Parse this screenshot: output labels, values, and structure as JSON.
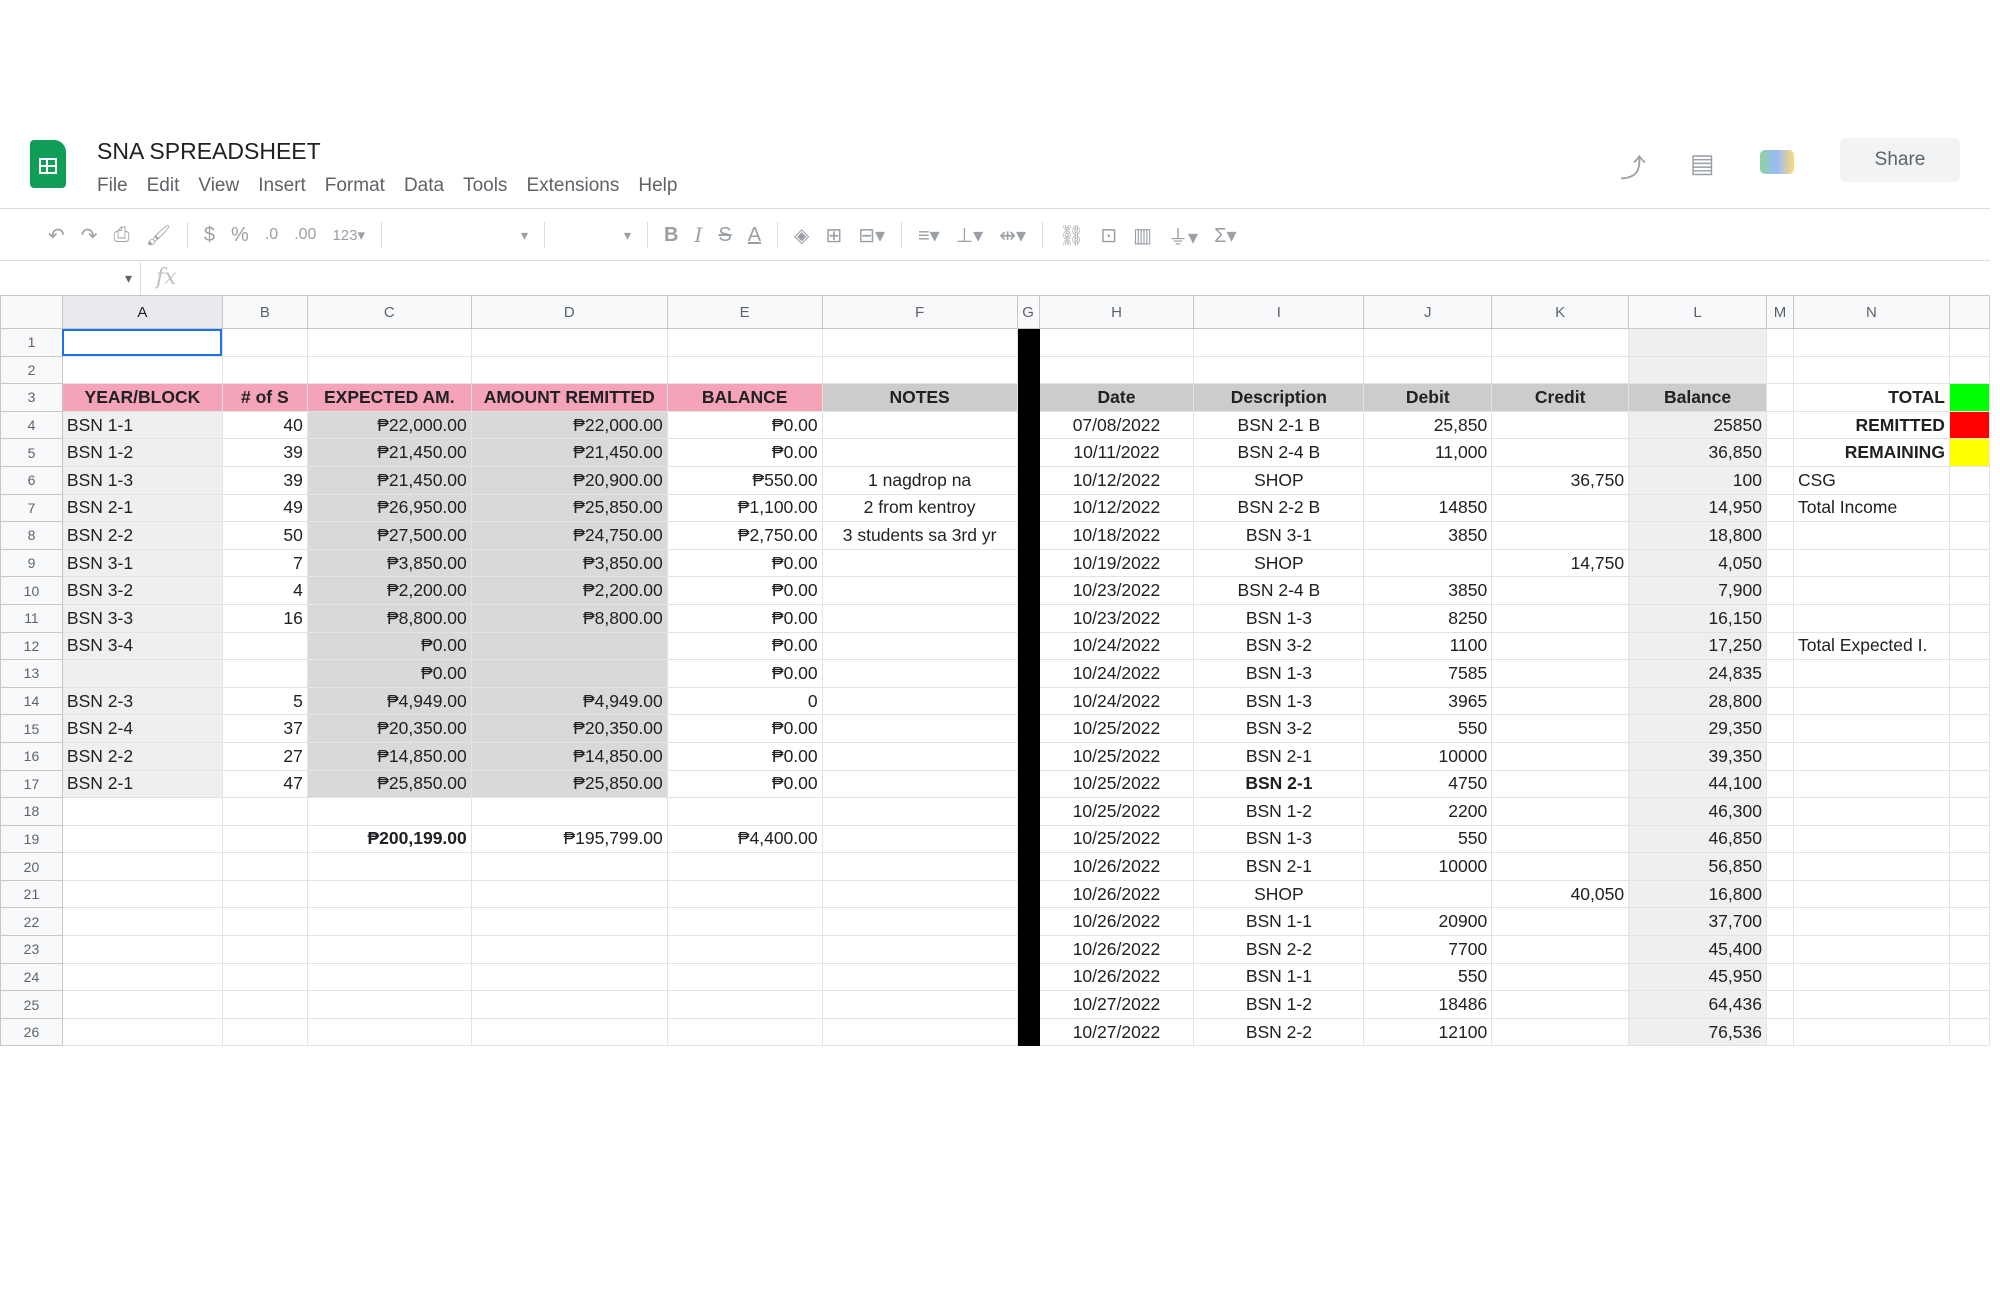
{
  "app": {
    "title": "SNA SPREADSHEET",
    "menu": [
      "File",
      "Edit",
      "View",
      "Insert",
      "Format",
      "Data",
      "Tools",
      "Extensions",
      "Help"
    ],
    "share_label": "Share"
  },
  "toolbar": {
    "currency": "$",
    "percent": "%",
    "dec_less": ".0",
    "dec_more": ".00",
    "format_more": "123▾",
    "fx": "fx"
  },
  "columns": [
    "A",
    "B",
    "C",
    "D",
    "E",
    "F",
    "G",
    "H",
    "I",
    "J",
    "K",
    "L",
    "M",
    "N"
  ],
  "rows": [
    {
      "n": "1"
    },
    {
      "n": "2"
    },
    {
      "n": "3",
      "A": "YEAR/BLOCK",
      "B": "# of S",
      "C": "EXPECTED AM.",
      "D": "AMOUNT REMITTED",
      "E": "BALANCE",
      "F": "NOTES",
      "H": "Date",
      "I": "Description",
      "J": "Debit",
      "K": "Credit",
      "L": "Balance",
      "N": "TOTAL"
    },
    {
      "n": "4",
      "A": "BSN 1-1",
      "B": "40",
      "C": "₱22,000.00",
      "D": "₱22,000.00",
      "E": "₱0.00",
      "H": "07/08/2022",
      "I": "BSN 2-1 B",
      "J": "25,850",
      "L": "25850",
      "N": "REMITTED"
    },
    {
      "n": "5",
      "A": "BSN 1-2",
      "B": "39",
      "C": "₱21,450.00",
      "D": "₱21,450.00",
      "E": "₱0.00",
      "H": "10/11/2022",
      "I": "BSN 2-4 B",
      "J": "11,000",
      "L": "36,850",
      "N": "REMAINING"
    },
    {
      "n": "6",
      "A": "BSN 1-3",
      "B": "39",
      "C": "₱21,450.00",
      "D": "₱20,900.00",
      "E": "₱550.00",
      "F": "1 nagdrop na",
      "H": "10/12/2022",
      "I": "SHOP",
      "K": "36,750",
      "L": "100",
      "N": "CSG"
    },
    {
      "n": "7",
      "A": "BSN 2-1",
      "B": "49",
      "C": "₱26,950.00",
      "D": "₱25,850.00",
      "E": "₱1,100.00",
      "F": "2 from kentroy",
      "H": "10/12/2022",
      "I": "BSN 2-2 B",
      "J": "14850",
      "L": "14,950",
      "N": "Total Income"
    },
    {
      "n": "8",
      "A": "BSN 2-2",
      "B": "50",
      "C": "₱27,500.00",
      "D": "₱24,750.00",
      "E": "₱2,750.00",
      "F": "3 students sa 3rd yr",
      "H": "10/18/2022",
      "I": "BSN 3-1",
      "J": "3850",
      "L": "18,800"
    },
    {
      "n": "9",
      "A": "BSN 3-1",
      "B": "7",
      "C": "₱3,850.00",
      "D": "₱3,850.00",
      "E": "₱0.00",
      "H": "10/19/2022",
      "I": "SHOP",
      "K": "14,750",
      "L": "4,050"
    },
    {
      "n": "10",
      "A": "BSN 3-2",
      "B": "4",
      "C": "₱2,200.00",
      "D": "₱2,200.00",
      "E": "₱0.00",
      "H": "10/23/2022",
      "I": "BSN 2-4 B",
      "J": "3850",
      "L": "7,900"
    },
    {
      "n": "11",
      "A": "BSN 3-3",
      "B": "16",
      "C": "₱8,800.00",
      "D": "₱8,800.00",
      "E": "₱0.00",
      "H": "10/23/2022",
      "I": "BSN 1-3",
      "J": "8250",
      "L": "16,150"
    },
    {
      "n": "12",
      "A": "BSN 3-4",
      "C": "₱0.00",
      "E": "₱0.00",
      "H": "10/24/2022",
      "I": "BSN 3-2",
      "J": "1100",
      "L": "17,250",
      "N": "Total Expected I."
    },
    {
      "n": "13",
      "C": "₱0.00",
      "E": "₱0.00",
      "H": "10/24/2022",
      "I": "BSN 1-3",
      "J": "7585",
      "L": "24,835"
    },
    {
      "n": "14",
      "A": "BSN 2-3",
      "B": "5",
      "C": "₱4,949.00",
      "D": "₱4,949.00",
      "E": "0",
      "H": "10/24/2022",
      "I": "BSN 1-3",
      "J": "3965",
      "L": "28,800"
    },
    {
      "n": "15",
      "A": "BSN 2-4",
      "B": "37",
      "C": "₱20,350.00",
      "D": "₱20,350.00",
      "E": "₱0.00",
      "H": "10/25/2022",
      "I": "BSN 3-2",
      "J": "550",
      "L": "29,350"
    },
    {
      "n": "16",
      "A": "BSN 2-2",
      "B": "27",
      "C": "₱14,850.00",
      "D": "₱14,850.00",
      "E": "₱0.00",
      "H": "10/25/2022",
      "I": "BSN 2-1",
      "J": "10000",
      "L": "39,350"
    },
    {
      "n": "17",
      "A": "BSN 2-1",
      "B": "47",
      "C": "₱25,850.00",
      "D": "₱25,850.00",
      "E": "₱0.00",
      "H": "10/25/2022",
      "I": "BSN 2-1",
      "J": "4750",
      "L": "44,100"
    },
    {
      "n": "18",
      "H": "10/25/2022",
      "I": "BSN 1-2",
      "J": "2200",
      "L": "46,300"
    },
    {
      "n": "19",
      "C": "₱200,199.00",
      "D": "₱195,799.00",
      "E": "₱4,400.00",
      "H": "10/25/2022",
      "I": "BSN 1-3",
      "J": "550",
      "L": "46,850"
    },
    {
      "n": "20",
      "H": "10/26/2022",
      "I": "BSN 2-1",
      "J": "10000",
      "L": "56,850"
    },
    {
      "n": "21",
      "H": "10/26/2022",
      "I": "SHOP",
      "K": "40,050",
      "L": "16,800"
    },
    {
      "n": "22",
      "H": "10/26/2022",
      "I": "BSN 1-1",
      "J": "20900",
      "L": "37,700"
    },
    {
      "n": "23",
      "H": "10/26/2022",
      "I": "BSN 2-2",
      "J": "7700",
      "L": "45,400"
    },
    {
      "n": "24",
      "H": "10/26/2022",
      "I": "BSN 1-1",
      "J": "550",
      "L": "45,950"
    },
    {
      "n": "25",
      "H": "10/27/2022",
      "I": "BSN 1-2",
      "J": "18486",
      "L": "64,436"
    },
    {
      "n": "26",
      "H": "10/27/2022",
      "I": "BSN 2-2",
      "J": "12100",
      "L": "76,536"
    }
  ],
  "colors": {
    "pink_header": "#f4a3b8",
    "gray_header": "#cccccc",
    "total": "#00ff00",
    "remitted": "#ff0000",
    "remaining": "#ffff00",
    "selection": "#1a73e8"
  }
}
